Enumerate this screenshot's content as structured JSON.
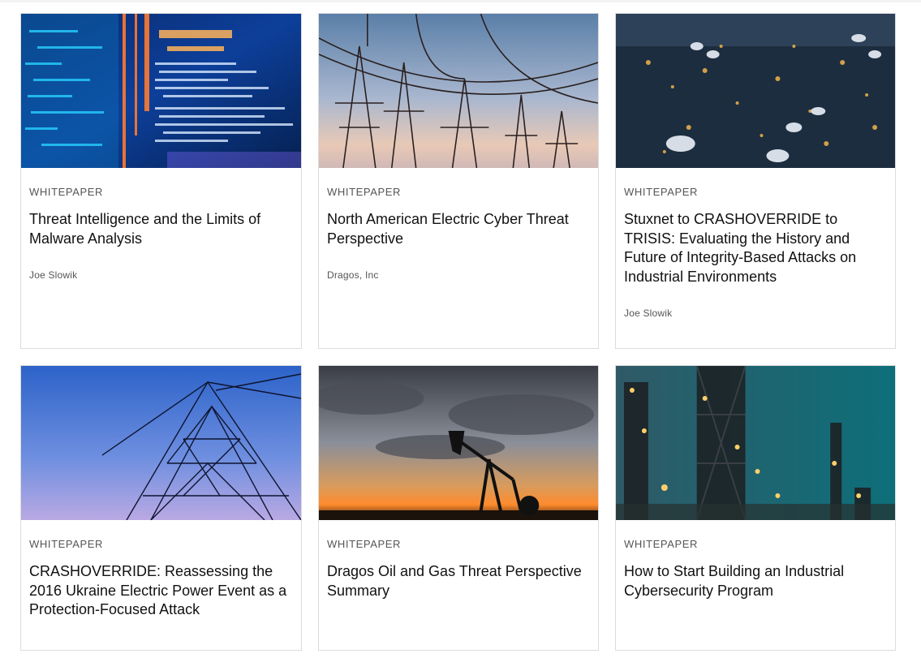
{
  "cards": [
    {
      "type": "WHITEPAPER",
      "title": "Threat Intelligence and the Limits of Malware Analysis",
      "author": "Joe Slowik",
      "image": "code-screen-image"
    },
    {
      "type": "WHITEPAPER",
      "title": "North American Electric Cyber Threat Perspective",
      "author": "Dragos, Inc",
      "image": "power-lines-image"
    },
    {
      "type": "WHITEPAPER",
      "title": "Stuxnet to CRASHOVERRIDE to TRISIS: Evaluating the History and Future of Integrity-Based Attacks on Industrial Environments",
      "author": "Joe Slowik",
      "image": "refinery-aerial-image"
    },
    {
      "type": "WHITEPAPER",
      "title": "CRASHOVERRIDE: Reassessing the 2016 Ukraine Electric Power Event as a Protection-Focused Attack",
      "author": "",
      "image": "transmission-tower-image"
    },
    {
      "type": "WHITEPAPER",
      "title": "Dragos Oil and Gas Threat Perspective Summary",
      "author": "",
      "image": "pumpjack-sunset-image"
    },
    {
      "type": "WHITEPAPER",
      "title": "How to Start Building an Industrial Cybersecurity Program",
      "author": "",
      "image": "industrial-plant-night-image"
    }
  ]
}
